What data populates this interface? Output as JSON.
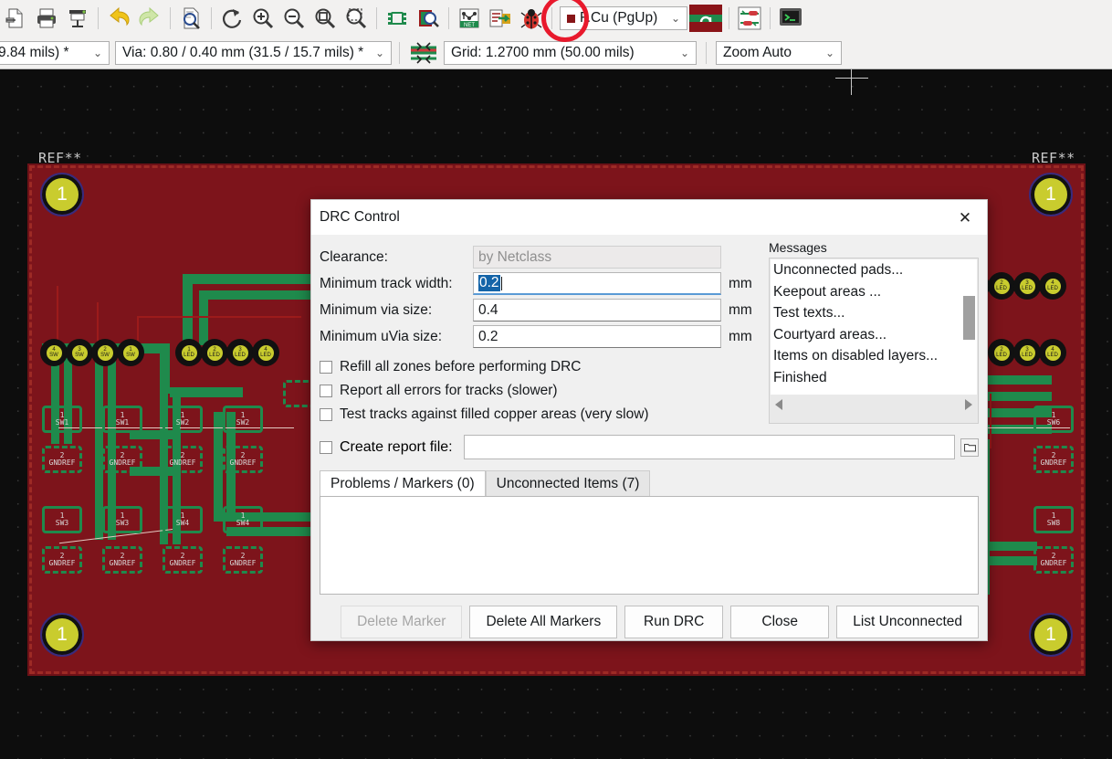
{
  "toolbar_top": {
    "icons": [
      {
        "name": "new-board-icon",
        "glyph": "page"
      },
      {
        "name": "print-icon",
        "glyph": "printer"
      },
      {
        "name": "plot-icon",
        "glyph": "plotter"
      },
      {
        "name": "undo-icon",
        "glyph": "undo"
      },
      {
        "name": "redo-icon",
        "glyph": "redo"
      },
      {
        "name": "print-preview-icon",
        "glyph": "preview"
      },
      {
        "name": "refresh-icon",
        "glyph": "refresh"
      },
      {
        "name": "zoom-in-icon",
        "glyph": "zoom-in"
      },
      {
        "name": "zoom-out-icon",
        "glyph": "zoom-out"
      },
      {
        "name": "zoom-fit-icon",
        "glyph": "zoom-fit"
      },
      {
        "name": "zoom-area-icon",
        "glyph": "zoom-area"
      },
      {
        "name": "footprint-editor-icon",
        "glyph": "footprints"
      },
      {
        "name": "footprint-viewer-icon",
        "glyph": "fp-viewer"
      },
      {
        "name": "netlist-icon",
        "glyph": "net"
      },
      {
        "name": "update-pcb-icon",
        "glyph": "update-pcb"
      },
      {
        "name": "drc-icon",
        "glyph": "ladybug"
      },
      {
        "name": "layers-setup-icon",
        "glyph": "layers-red"
      },
      {
        "name": "design-rules-icon",
        "glyph": "design-rules"
      },
      {
        "name": "3d-viewer-icon",
        "glyph": "viewer3d"
      }
    ],
    "layer_combo": {
      "label": "F.Cu (PgUp)",
      "swatch": "#871518"
    }
  },
  "toolbar_second": {
    "track_combo": "9.84 mils) *",
    "via_combo": "Via: 0.80 / 0.40 mm (31.5 / 15.7 mils) *",
    "grid_combo": "Grid: 1.2700 mm (50.00 mils)",
    "zoom_combo": "Zoom Auto",
    "diff_pair_icon": "differential-pair-icon"
  },
  "canvas": {
    "refdes_left": "REF**",
    "refdes_right": "REF**",
    "mount_holes": [
      "1",
      "1",
      "1",
      "1"
    ],
    "vias_left_group1": [
      {
        "pin": "4",
        "net": "SW"
      },
      {
        "pin": "3",
        "net": "SW"
      },
      {
        "pin": "2",
        "net": "SW"
      },
      {
        "pin": "1",
        "net": "SW"
      }
    ],
    "vias_left_group2": [
      {
        "pin": "1",
        "net": "LED"
      },
      {
        "pin": "2",
        "net": "LED"
      },
      {
        "pin": "3",
        "net": "LED"
      },
      {
        "pin": "4",
        "net": "LED"
      }
    ],
    "vias_right_group1": [
      {
        "pin": "1",
        "net": "LED"
      },
      {
        "pin": "2",
        "net": "LED"
      },
      {
        "pin": "3",
        "net": "LED"
      },
      {
        "pin": "4",
        "net": "LED"
      }
    ],
    "vias_right_group2": [
      {
        "pin": "2",
        "net": "LED"
      },
      {
        "pin": "3",
        "net": "LED"
      },
      {
        "pin": "4",
        "net": "LED"
      }
    ],
    "pads_left": [
      {
        "pin": "1",
        "ref": "SW1"
      },
      {
        "pin": "1",
        "ref": "SW1"
      },
      {
        "pin": "1",
        "ref": "SW2"
      },
      {
        "pin": "1",
        "ref": "SW2"
      },
      {
        "pin": "2",
        "ref": "GNDREF"
      },
      {
        "pin": "2",
        "ref": "GNDREF"
      },
      {
        "pin": "2",
        "ref": "GNDREF"
      },
      {
        "pin": "2",
        "ref": "GNDREF"
      },
      {
        "pin": "1",
        "ref": "SW3"
      },
      {
        "pin": "1",
        "ref": "SW3"
      },
      {
        "pin": "1",
        "ref": "SW4"
      },
      {
        "pin": "1",
        "ref": "SW4"
      },
      {
        "pin": "2",
        "ref": "GNDREF"
      },
      {
        "pin": "2",
        "ref": "GNDREF"
      },
      {
        "pin": "2",
        "ref": "GNDREF"
      },
      {
        "pin": "2",
        "ref": "GNDREF"
      }
    ],
    "pads_right": [
      {
        "pin": "1",
        "ref": "SW6"
      },
      {
        "pin": "2",
        "ref": "GNDREF"
      },
      {
        "pin": "1",
        "ref": "SW8"
      },
      {
        "pin": "2",
        "ref": "GNDREF"
      }
    ],
    "colors": {
      "board": "#7d141b",
      "copper_zone": "#1f8a4c",
      "via_pad": "#c9cc2e",
      "background": "#0d0d0d",
      "ratsnest": "#e3c9c2"
    }
  },
  "dialog": {
    "title": "DRC Control",
    "close_label": "✕",
    "fields": [
      {
        "label": "Clearance:",
        "value": "by Netclass",
        "unit": "",
        "disabled": true,
        "focused": false
      },
      {
        "label": "Minimum track width:",
        "value": "0.2",
        "unit": "mm",
        "disabled": false,
        "focused": true
      },
      {
        "label": "Minimum via size:",
        "value": "0.4",
        "unit": "mm",
        "disabled": false,
        "focused": false
      },
      {
        "label": "Minimum uVia size:",
        "value": "0.2",
        "unit": "mm",
        "disabled": false,
        "focused": false
      }
    ],
    "messages_title": "Messages",
    "messages": [
      "Unconnected pads...",
      "Keepout areas ...",
      "Test texts...",
      "Courtyard areas...",
      "Items on disabled layers...",
      "Finished"
    ],
    "checkboxes": [
      {
        "label": "Refill all zones before performing DRC",
        "checked": false
      },
      {
        "label": "Report all errors for tracks (slower)",
        "checked": false
      },
      {
        "label": "Test tracks against filled copper areas (very slow)",
        "checked": false
      }
    ],
    "report": {
      "label": "Create report file:",
      "checked": false,
      "value": "",
      "placeholder": "",
      "browse_icon": "folder-icon"
    },
    "tabs": [
      {
        "label": "Problems / Markers (0)",
        "active": true
      },
      {
        "label": "Unconnected Items (7)",
        "active": false
      }
    ],
    "buttons": [
      {
        "label": "Delete Marker",
        "disabled": true
      },
      {
        "label": "Delete All Markers",
        "disabled": false
      },
      {
        "label": "Run DRC",
        "disabled": false
      },
      {
        "label": "Close",
        "disabled": false
      },
      {
        "label": "List Unconnected",
        "disabled": false
      }
    ]
  }
}
